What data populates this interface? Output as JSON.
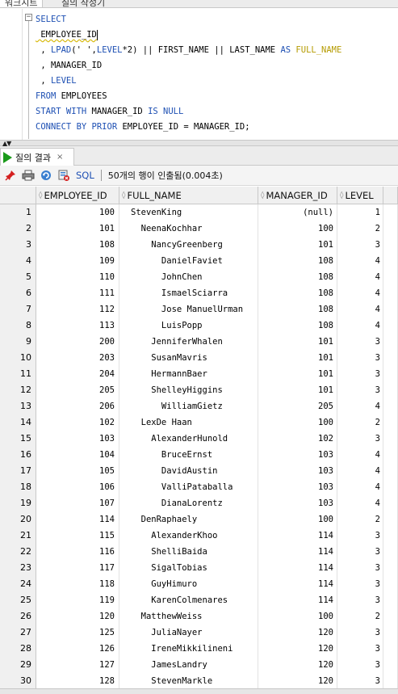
{
  "top_tabs": [
    "워크시트",
    "질의 작성기"
  ],
  "editor": {
    "lines": [
      [
        {
          "t": "SELECT",
          "c": "kw"
        }
      ],
      [
        {
          "t": " EMPLOYEE_ID",
          "c": "squig"
        }
      ],
      [
        {
          "t": " , ",
          "c": ""
        },
        {
          "t": "LPAD",
          "c": "kw"
        },
        {
          "t": "(' ',",
          "c": ""
        },
        {
          "t": "LEVEL",
          "c": "kw"
        },
        {
          "t": "*2) || FIRST_NAME || LAST_NAME ",
          "c": ""
        },
        {
          "t": "AS",
          "c": "kw"
        },
        {
          "t": " FULL_NAME",
          "c": "alias"
        }
      ],
      [
        {
          "t": " , MANAGER_ID",
          "c": ""
        }
      ],
      [
        {
          "t": " , ",
          "c": ""
        },
        {
          "t": "LEVEL",
          "c": "kw"
        }
      ],
      [
        {
          "t": "FROM",
          "c": "kw"
        },
        {
          "t": " EMPLOYEES",
          "c": ""
        }
      ],
      [
        {
          "t": "START WITH",
          "c": "kw"
        },
        {
          "t": " MANAGER_ID ",
          "c": ""
        },
        {
          "t": "IS NULL",
          "c": "kw"
        }
      ],
      [
        {
          "t": "CONNECT BY PRIOR",
          "c": "kw"
        },
        {
          "t": " EMPLOYEE_ID = MANAGER_ID;",
          "c": ""
        }
      ]
    ]
  },
  "results_tab": {
    "label": "질의 결과",
    "close": "×"
  },
  "toolbar": {
    "sql_label": "SQL",
    "status": "50개의 행이 인출됨(0.004초)"
  },
  "columns": [
    "EMPLOYEE_ID",
    "FULL_NAME",
    "MANAGER_ID",
    "LEVEL"
  ],
  "rows": [
    [
      "1",
      "100",
      "StevenKing",
      "(null)",
      "1"
    ],
    [
      "2",
      "101",
      "  NeenaKochhar",
      "100",
      "2"
    ],
    [
      "3",
      "108",
      "    NancyGreenberg",
      "101",
      "3"
    ],
    [
      "4",
      "109",
      "      DanielFaviet",
      "108",
      "4"
    ],
    [
      "5",
      "110",
      "      JohnChen",
      "108",
      "4"
    ],
    [
      "6",
      "111",
      "      IsmaelSciarra",
      "108",
      "4"
    ],
    [
      "7",
      "112",
      "      Jose ManuelUrman",
      "108",
      "4"
    ],
    [
      "8",
      "113",
      "      LuisPopp",
      "108",
      "4"
    ],
    [
      "9",
      "200",
      "    JenniferWhalen",
      "101",
      "3"
    ],
    [
      "10",
      "203",
      "    SusanMavris",
      "101",
      "3"
    ],
    [
      "11",
      "204",
      "    HermannBaer",
      "101",
      "3"
    ],
    [
      "12",
      "205",
      "    ShelleyHiggins",
      "101",
      "3"
    ],
    [
      "13",
      "206",
      "      WilliamGietz",
      "205",
      "4"
    ],
    [
      "14",
      "102",
      "  LexDe Haan",
      "100",
      "2"
    ],
    [
      "15",
      "103",
      "    AlexanderHunold",
      "102",
      "3"
    ],
    [
      "16",
      "104",
      "      BruceErnst",
      "103",
      "4"
    ],
    [
      "17",
      "105",
      "      DavidAustin",
      "103",
      "4"
    ],
    [
      "18",
      "106",
      "      ValliPataballa",
      "103",
      "4"
    ],
    [
      "19",
      "107",
      "      DianaLorentz",
      "103",
      "4"
    ],
    [
      "20",
      "114",
      "  DenRaphaely",
      "100",
      "2"
    ],
    [
      "21",
      "115",
      "    AlexanderKhoo",
      "114",
      "3"
    ],
    [
      "22",
      "116",
      "    ShelliBaida",
      "114",
      "3"
    ],
    [
      "23",
      "117",
      "    SigalTobias",
      "114",
      "3"
    ],
    [
      "24",
      "118",
      "    GuyHimuro",
      "114",
      "3"
    ],
    [
      "25",
      "119",
      "    KarenColmenares",
      "114",
      "3"
    ],
    [
      "26",
      "120",
      "  MatthewWeiss",
      "100",
      "2"
    ],
    [
      "27",
      "125",
      "    JuliaNayer",
      "120",
      "3"
    ],
    [
      "28",
      "126",
      "    IreneMikkilineni",
      "120",
      "3"
    ],
    [
      "29",
      "127",
      "    JamesLandry",
      "120",
      "3"
    ],
    [
      "30",
      "128",
      "    StevenMarkle",
      "120",
      "3"
    ]
  ]
}
